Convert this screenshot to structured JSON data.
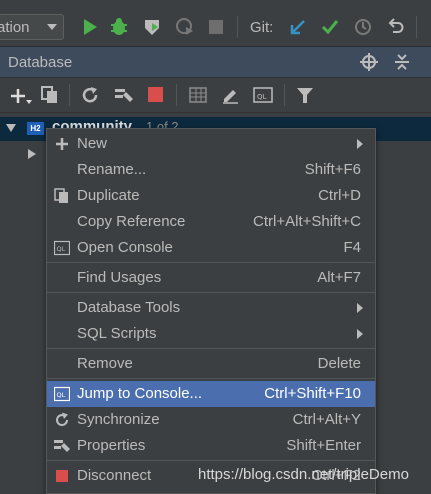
{
  "run_toolbar": {
    "config_value": "ation",
    "git_label": "Git:",
    "colors": {
      "run": "#4cb04c",
      "debug": "#4cb04c",
      "git_update": "#3592c4",
      "git_commit": "#4cb04c"
    }
  },
  "db_panel": {
    "title": "Database"
  },
  "tree": {
    "db_name": "community",
    "db_count": "1 of 2",
    "db_badge": "H2"
  },
  "context_menu": {
    "items": [
      {
        "label": "New",
        "shortcut": "",
        "submenu": true,
        "icon": "plus-icon"
      },
      {
        "label": "Rename...",
        "shortcut": "Shift+F6",
        "submenu": false,
        "icon": ""
      },
      {
        "label": "Duplicate",
        "shortcut": "Ctrl+D",
        "submenu": false,
        "icon": "duplicate-icon"
      },
      {
        "label": "Copy Reference",
        "shortcut": "Ctrl+Alt+Shift+C",
        "submenu": false,
        "icon": ""
      },
      {
        "label": "Open Console",
        "shortcut": "F4",
        "submenu": false,
        "icon": "console-icon"
      },
      {
        "label": "Find Usages",
        "shortcut": "Alt+F7",
        "submenu": false,
        "icon": ""
      },
      {
        "label": "Database Tools",
        "shortcut": "",
        "submenu": true,
        "icon": ""
      },
      {
        "label": "SQL Scripts",
        "shortcut": "",
        "submenu": true,
        "icon": ""
      },
      {
        "label": "Remove",
        "shortcut": "Delete",
        "submenu": false,
        "icon": ""
      },
      {
        "label": "Jump to Console...",
        "shortcut": "Ctrl+Shift+F10",
        "submenu": false,
        "icon": "console-icon",
        "selected": true
      },
      {
        "label": "Synchronize",
        "shortcut": "Ctrl+Alt+Y",
        "submenu": false,
        "icon": "refresh-icon"
      },
      {
        "label": "Properties",
        "shortcut": "Shift+Enter",
        "submenu": false,
        "icon": "properties-icon"
      },
      {
        "label": "Disconnect",
        "shortcut": "Ctrl+F2",
        "submenu": false,
        "icon": "stop-icon"
      }
    ],
    "selected_color": "#4b6eaf"
  },
  "watermark": "https://blog.csdn.net/tripleDemo"
}
